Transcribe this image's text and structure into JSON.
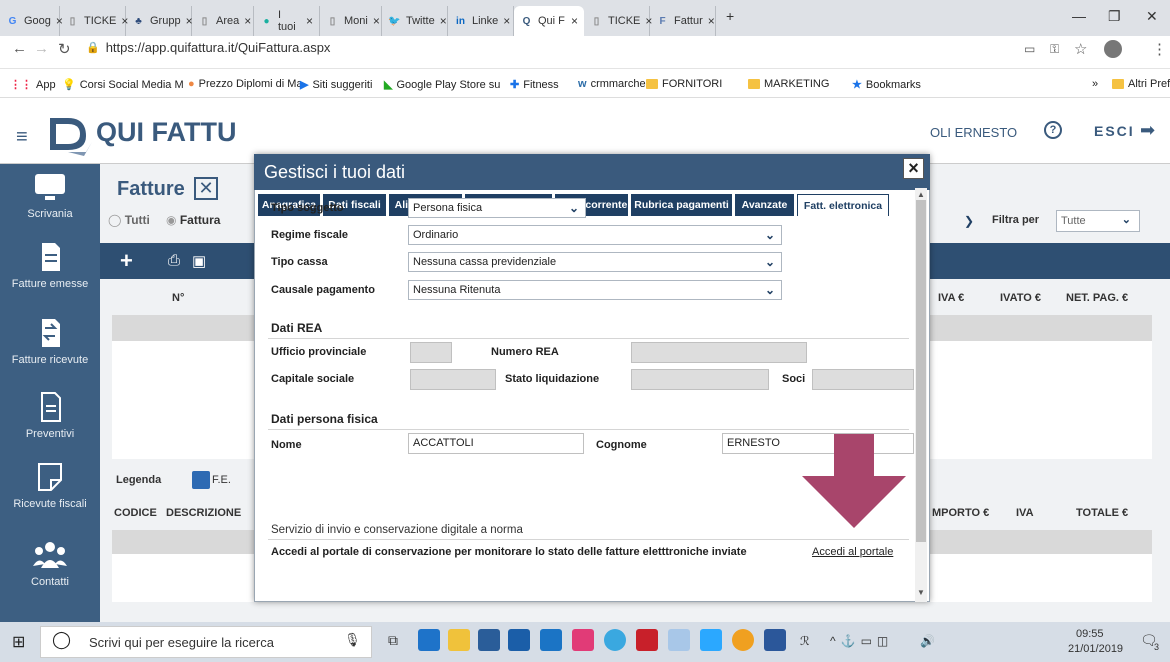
{
  "browser": {
    "tabs": [
      {
        "label": "Goog",
        "close": "×",
        "icon": "G",
        "color": "#4285f4"
      },
      {
        "label": "TICKE",
        "close": "×",
        "icon": "▯",
        "color": "#888"
      },
      {
        "label": "Grupp",
        "close": "×",
        "icon": "♣",
        "color": "#2c4a7a"
      },
      {
        "label": "Area",
        "close": "×",
        "icon": "▯",
        "color": "#888"
      },
      {
        "label": "I tuoi",
        "close": "×",
        "icon": "●",
        "color": "#1ab0a0"
      },
      {
        "label": "Moni",
        "close": "×",
        "icon": "▯",
        "color": "#888"
      },
      {
        "label": "Twitte",
        "close": "×",
        "icon": "🐦",
        "color": "#1da1f2"
      },
      {
        "label": "Linke",
        "close": "×",
        "icon": "in",
        "color": "#0a66c2"
      },
      {
        "label": "Qui F",
        "close": "×",
        "icon": "Q",
        "color": "#3a5a7d"
      },
      {
        "label": "TICKE",
        "close": "×",
        "icon": "▯",
        "color": "#888"
      },
      {
        "label": "Fattur",
        "close": "×",
        "icon": "F",
        "color": "#5a7ab0"
      }
    ],
    "new_tab": "+",
    "url": "https://app.quifattura.it/QuiFattura.aspx",
    "bookmarks": [
      {
        "label": "App",
        "icon": "grid"
      },
      {
        "label": "Corsi Social Media M",
        "icon": "bulb"
      },
      {
        "label": "Prezzo Diplomi di Ma",
        "icon": "leaf"
      },
      {
        "label": "Siti suggeriti",
        "icon": "blue"
      },
      {
        "label": "Google Play Store su",
        "icon": "play"
      },
      {
        "label": "Fitness",
        "icon": "plus"
      },
      {
        "label": "crmmarche",
        "icon": "wp"
      },
      {
        "label": "FORNITORI",
        "icon": "folder"
      },
      {
        "label": "MARKETING",
        "icon": "folder"
      },
      {
        "label": "Bookmarks",
        "icon": "star"
      }
    ],
    "more": "»",
    "other_bookmarks": "Altri Preferiti"
  },
  "app": {
    "logo_text": "QUI FATTU",
    "user": "OLI ERNESTO",
    "help": "?",
    "logout": "ESCI",
    "page_title": "Fatture",
    "filter_tutti": "Tutti",
    "filter_fattura": "Fattura",
    "filtra_per": "Filtra per",
    "filtra_value": "Tutte",
    "grid_headers": [
      "N°",
      "IVA €",
      "IVATO €",
      "NET. PAG. €"
    ],
    "legenda": "Legenda",
    "legenda_fe": "F.E.",
    "detail_headers": [
      "CODICE",
      "DESCRIZIONE",
      "MPORTO €",
      "IVA",
      "TOTALE €"
    ],
    "sidebar": [
      "Scrivania",
      "Fatture emesse",
      "Fatture ricevute",
      "Preventivi",
      "Ricevute fiscali",
      "Contatti"
    ]
  },
  "modal": {
    "title": "Gestisci i tuoi dati",
    "close": "×",
    "tabs": [
      "Anagrafica",
      "Dati fiscali",
      "Aliquote IVA",
      "Unità di misura",
      "Conti corrente",
      "Rubrica pagamenti",
      "Avanzate",
      "Fatt. elettronica"
    ],
    "active_tab": "Fatt. elettronica",
    "tipo_soggetto_label": "Tipo soggetto",
    "tipo_soggetto_value": "Persona fisica",
    "regime_label": "Regime fiscale",
    "regime_value": "Ordinario",
    "cassa_label": "Tipo cassa",
    "cassa_value": "Nessuna cassa previdenziale",
    "causale_label": "Causale pagamento",
    "causale_value": "Nessuna Ritenuta",
    "rea_header": "Dati REA",
    "ufficio_label": "Ufficio provinciale",
    "numero_rea_label": "Numero REA",
    "capitale_label": "Capitale sociale",
    "stato_label": "Stato liquidazione",
    "soci_label": "Soci",
    "persona_header": "Dati persona fisica",
    "nome_label": "Nome",
    "nome_value": "ACCATTOLI",
    "cognome_label": "Cognome",
    "cognome_value": "ERNESTO",
    "servizio_header": "Servizio di invio e conservazione digitale a norma",
    "portale_text": "Accedi al portale di conservazione per monitorare lo stato delle fatture eletttroniche inviate",
    "portale_link": "Accedi al portale"
  },
  "taskbar": {
    "search": "Scrivi qui per eseguire la ricerca",
    "time": "09:55",
    "date": "21/01/2019",
    "notif": "3"
  },
  "colors": {
    "accent": "#3a5a7d",
    "arrow": "#a8456b"
  }
}
